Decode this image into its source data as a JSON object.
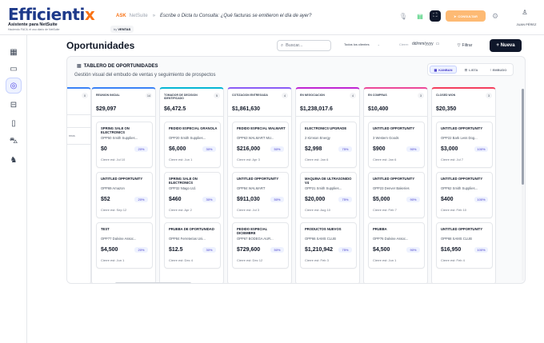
{
  "app": {
    "logo_main": "Efficienti",
    "logo_accent": "x",
    "tagline": "Asistente para NetSuite",
    "subtagline": "Haciendo FACIL el uso diario de NetSuite"
  },
  "ask": {
    "label": "ASK",
    "suite": "NetSuite",
    "separator": "»",
    "prompt": "Escribe o Dicta tu Consulta: ¿Qué facturas se emitieron el día de ayer?",
    "context_prefix": "by",
    "context_value": "VENTAS"
  },
  "header": {
    "consult_label": "CONSULTAR",
    "user_name": "JUAN PÉREZ"
  },
  "page": {
    "title": "Oportunidades",
    "search_placeholder": "Buscar...",
    "client_filter": "Todos los clientes",
    "cierre_label": "Cierre:",
    "date_placeholder": "dd/mm/yyyy",
    "filter_label": "Filtrar",
    "new_label": "+ Nueva"
  },
  "board": {
    "title": "TABLERO DE OPORTUNIDADES",
    "subtitle": "Gestión visual del embudo de ventas y seguimiento de prospectos",
    "views": [
      "KANBAN",
      "LISTA",
      "EMBUDO"
    ],
    "partial_column": {
      "count": "0",
      "card_text": "rmos"
    }
  },
  "columns": [
    {
      "name": "REUNION INICIAL",
      "count": "14",
      "total": "$29,097",
      "color": "#3b82f6",
      "cards": [
        {
          "title": "SPRING SALE ON ELECTRONICS",
          "client": "OPP50 Smith Supplies...",
          "amount": "$0",
          "pct": "20%",
          "close": "Cierre est: Jul 10"
        },
        {
          "title": "UNTITLED OPPORTUNITY",
          "client": "OPP69 Amazon",
          "amount": "$52",
          "pct": "20%",
          "close": "Cierre est: Sep 12"
        },
        {
          "title": "TEST",
          "client": "OPP77 Dalvine Assoc...",
          "amount": "$4,500",
          "pct": "20%",
          "close": "Cierre est: Jun 1"
        }
      ]
    },
    {
      "name": "TOMADOR DE DECISION IDENTIFICADO",
      "count": "5",
      "total": "$6,472.5",
      "color": "#06b6d4",
      "cards": [
        {
          "title": "PEDIDO ESPECIAL GRANOLA",
          "client": "OPP20 Smith Supplies...",
          "amount": "$6,000",
          "pct": "30%",
          "close": "Cierre est: Jun 1"
        },
        {
          "title": "SPRING SALE ON ELECTRONICS",
          "client": "OPP32 Ntago Ltd.",
          "amount": "$460",
          "pct": "30%",
          "close": "Cierre est: Apr 2"
        },
        {
          "title": "PRUEBA DE OPORTUNIDAD",
          "client": "OPP84 Ferreterias Uni...",
          "amount": "$12.5",
          "pct": "30%",
          "close": "Cierre est: Dec 4"
        }
      ]
    },
    {
      "name": "COTIZACION ENTREGADA",
      "count": "4",
      "total": "$1,861,630",
      "color": "#8b5cf6",
      "cards": [
        {
          "title": "PEDIDO ESPECIAL WALMART",
          "client": "OPP63 WALMART MU...",
          "amount": "$216,000",
          "pct": "50%",
          "close": "Cierre est: Apr 3"
        },
        {
          "title": "UNTITLED OPPORTUNITY",
          "client": "OPP84 WALMART",
          "amount": "$911,030",
          "pct": "50%",
          "close": "Cierre est: Jul 3"
        },
        {
          "title": "PEDIDO ESPECIAL DICIEMBRE",
          "client": "OPP67 BODEGA AUR...",
          "amount": "$729,600",
          "pct": "50%",
          "close": "Cierre est: Dec 12"
        }
      ]
    },
    {
      "name": "EN NEGOCIACION",
      "count": "4",
      "total": "$1,238,017.6",
      "color": "#c026d3",
      "cards": [
        {
          "title": "ELECTRONICS UPGRADE",
          "client": "2 Kimson Energy",
          "amount": "$2,998",
          "pct": "75%",
          "close": "Cierre est: Jan 6"
        },
        {
          "title": "MAQUINA DE ULTRASONIDO V4",
          "client": "OPP21 Smith Supplies...",
          "amount": "$20,000",
          "pct": "75%",
          "close": "Cierre est: Aug 10"
        },
        {
          "title": "PRODUCTOS NUEVOS",
          "client": "OPP66 SAMS CLUB",
          "amount": "$1,210,942",
          "pct": "75%",
          "close": "Cierre est: Feb 3"
        }
      ]
    },
    {
      "name": "EN COMPRAS",
      "count": "3",
      "total": "$10,400",
      "color": "#ec4899",
      "cards": [
        {
          "title": "UNTITLED OPPORTUNITY",
          "client": "3 Western Goods",
          "amount": "$900",
          "pct": "90%",
          "close": "Cierre est: Jan 6"
        },
        {
          "title": "UNTITLED OPPORTUNITY",
          "client": "OPP23 Denver Bakeries",
          "amount": "$5,000",
          "pct": "90%",
          "close": "Cierre est: Feb 7"
        },
        {
          "title": "PRUEBA",
          "client": "OPP76 Dalvine Assoc...",
          "amount": "$4,500",
          "pct": "90%",
          "close": "Cierre est: Jun 1"
        }
      ]
    },
    {
      "name": "CLOSED WON",
      "count": "3",
      "total": "$20,350",
      "color": "#f43f5e",
      "cards": [
        {
          "title": "UNTITLED OPPORTUNITY",
          "client": "OPP22 Bark Less Dog...",
          "amount": "$3,000",
          "pct": "100%",
          "close": "Cierre est: Jul 7"
        },
        {
          "title": "UNTITLED OPPORTUNITY",
          "client": "OPP62 Smith Supplies...",
          "amount": "$400",
          "pct": "100%",
          "close": "Cierre est: Feb 10"
        },
        {
          "title": "UNTITLED OPPORTUNITY",
          "client": "OPP68 SAMS CLUB",
          "amount": "$16,950",
          "pct": "100%",
          "close": "Cierre est: Feb 4"
        }
      ]
    }
  ],
  "icons": {
    "sidebar": [
      "grid-icon",
      "calendar-icon",
      "target-icon",
      "chart-icon",
      "document-icon",
      "cart-icon",
      "users-icon"
    ],
    "colors": {
      "accent": "#f97316",
      "primary": "#1e3a8a",
      "active": "#4f46e5"
    }
  }
}
